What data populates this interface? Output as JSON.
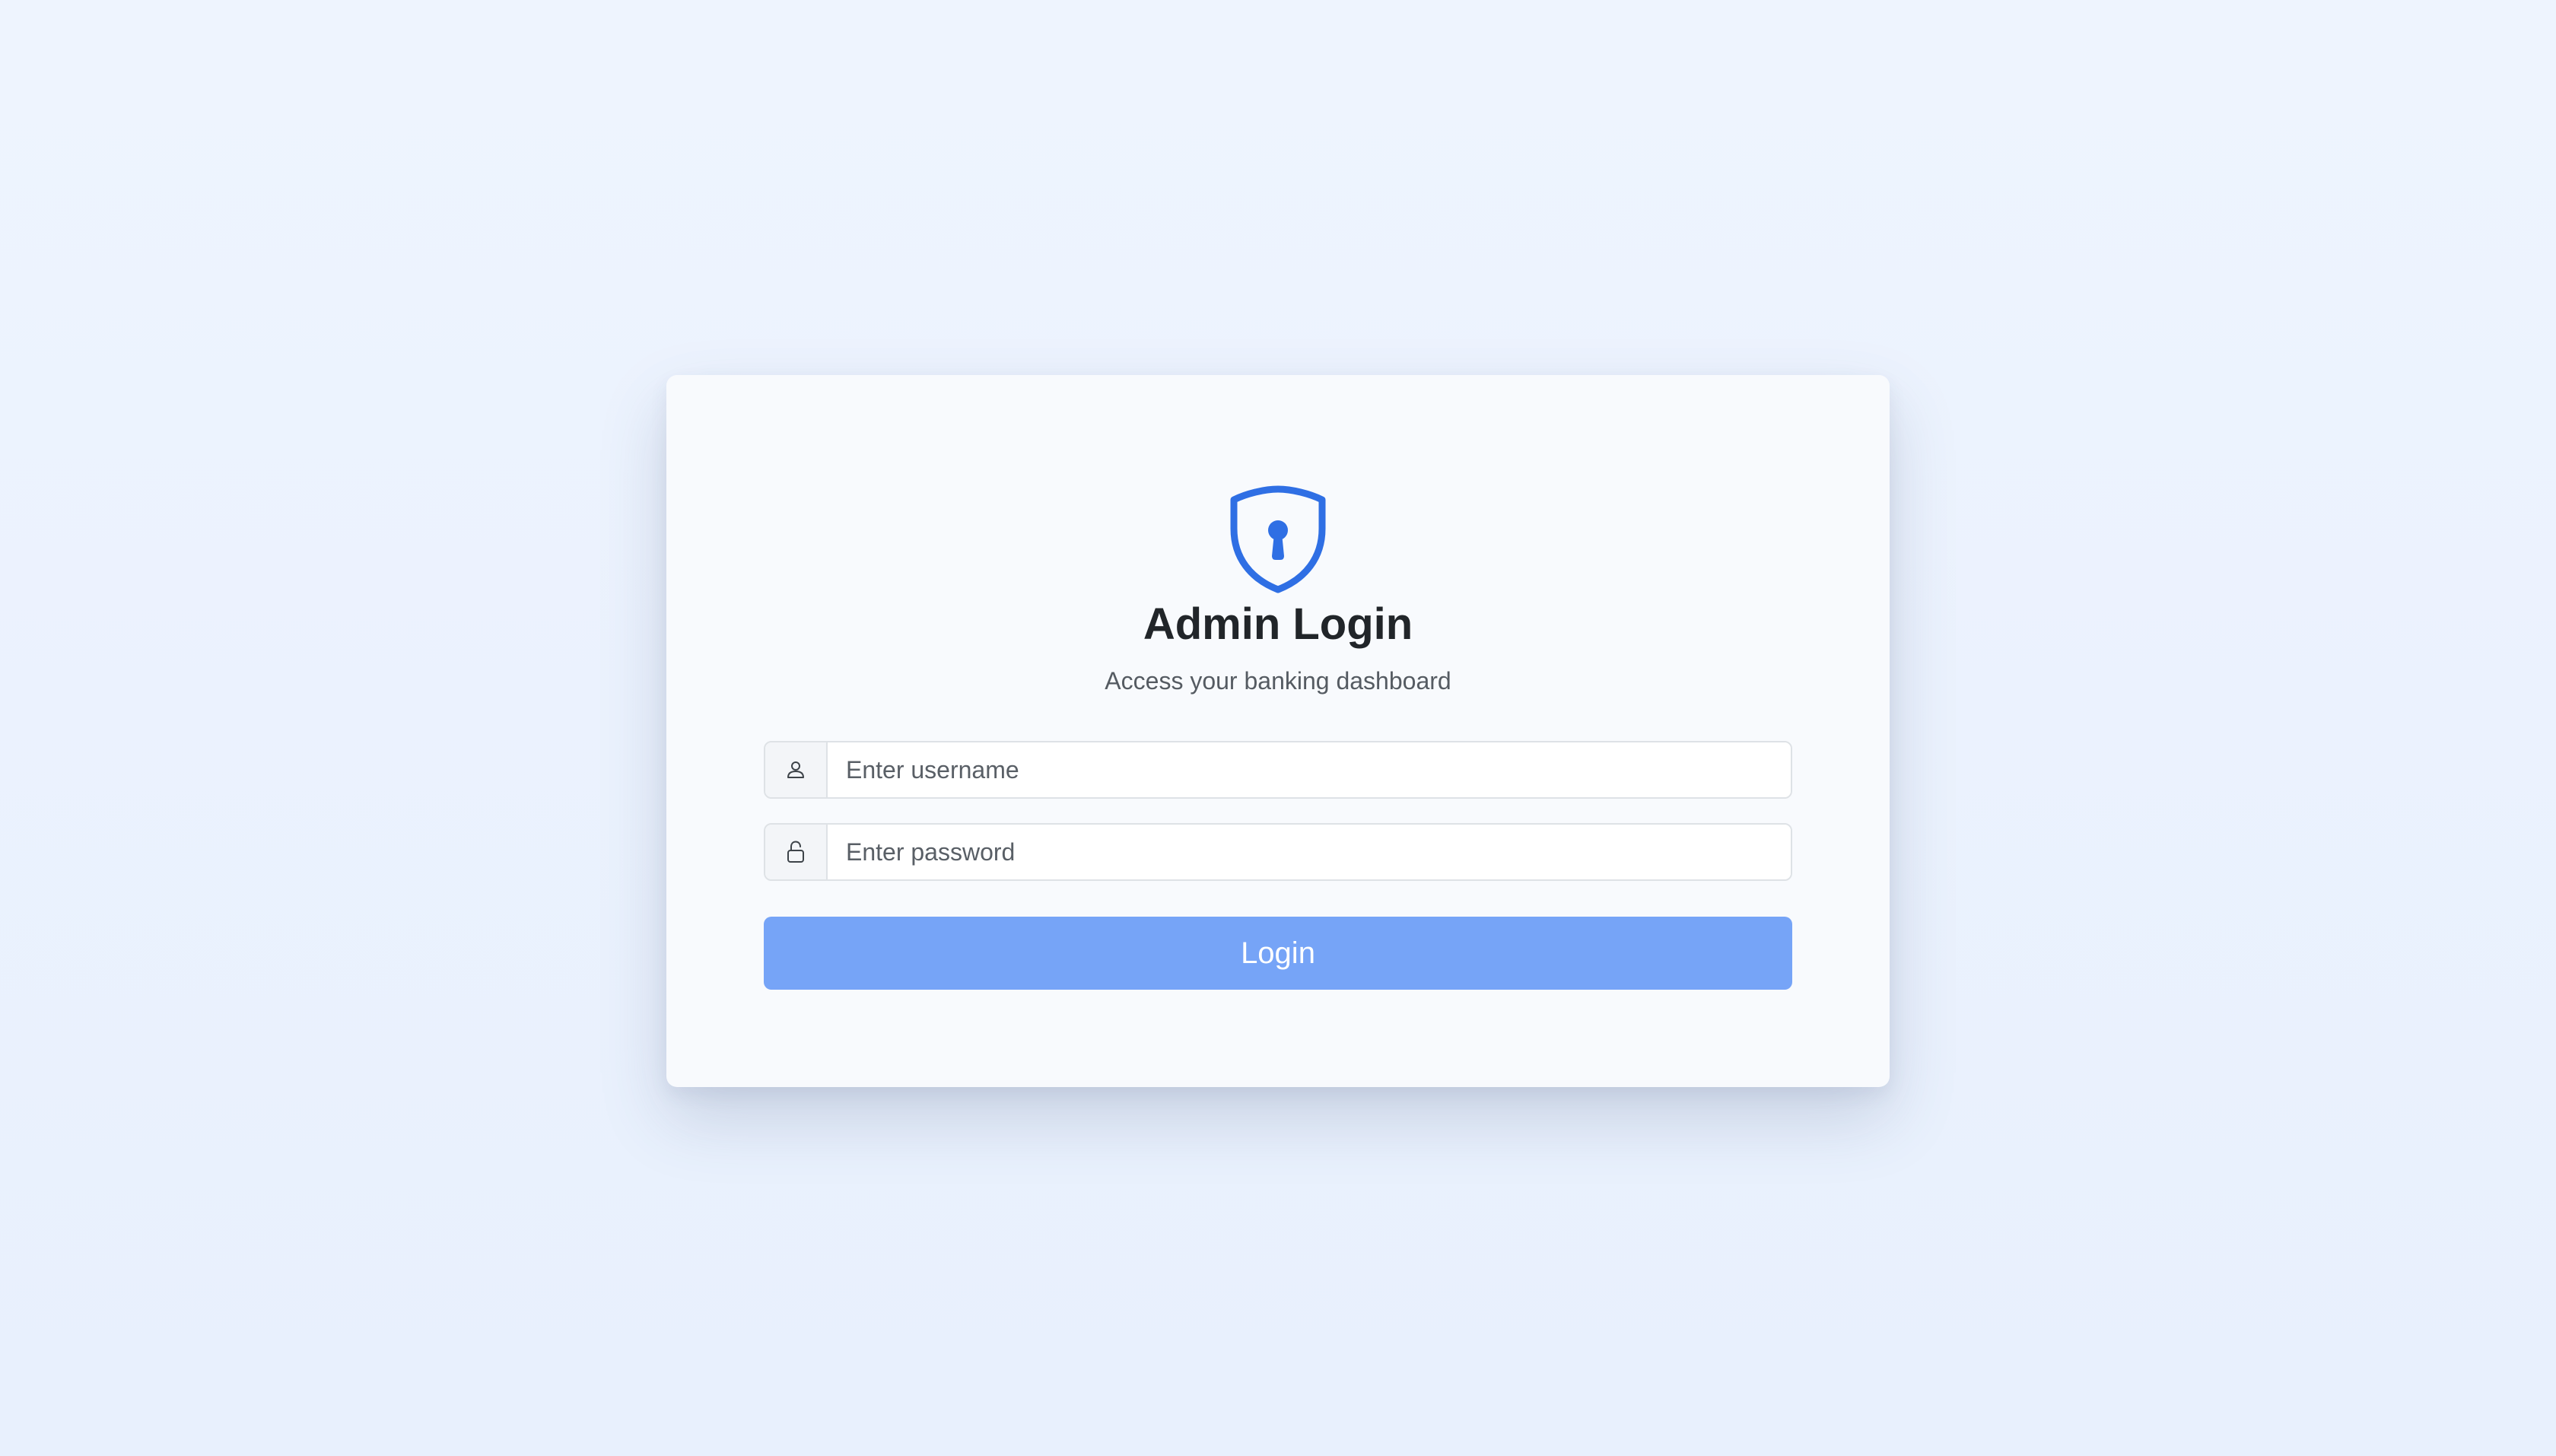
{
  "login": {
    "title": "Admin Login",
    "subtitle": "Access your banking dashboard",
    "username_placeholder": "Enter username",
    "password_placeholder": "Enter password",
    "login_label": "Login"
  },
  "icons": {
    "logo": "shield-keyhole-icon",
    "username": "person-icon",
    "password": "lock-icon"
  },
  "colors": {
    "background": "#eaf1fd",
    "card": "#f8fafd",
    "accent": "#2f6fe4",
    "button": "#76a4f7",
    "title": "#212529",
    "subtitle": "#555b62"
  }
}
